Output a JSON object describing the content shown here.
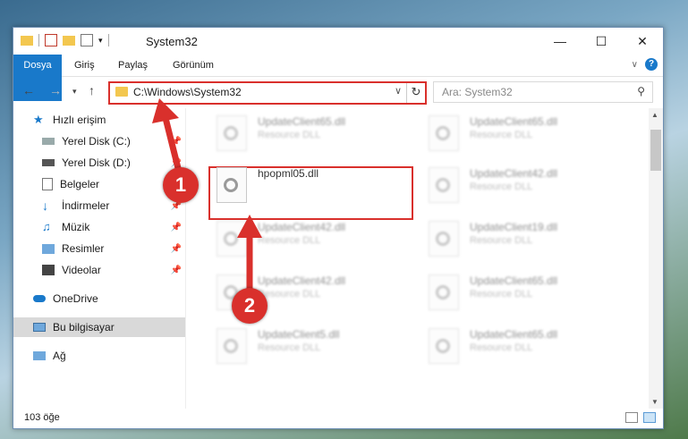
{
  "window": {
    "title": "System32",
    "controls": [
      "minimize-icon",
      "maximize-icon",
      "close-icon"
    ]
  },
  "ribbon": {
    "tabs": [
      "Dosya",
      "Giriş",
      "Paylaş",
      "Görünüm"
    ],
    "accent": "#1979ca"
  },
  "address": {
    "path": "C:\\Windows\\System32",
    "search_placeholder": "Ara: System32"
  },
  "sidebar": {
    "items": [
      {
        "label": "Hızlı erişim",
        "icon": "star-icon",
        "pinned": false
      },
      {
        "label": "Yerel Disk (C:)",
        "icon": "drive-icon",
        "pinned": true
      },
      {
        "label": "Yerel Disk (D:)",
        "icon": "drive-icon",
        "pinned": true
      },
      {
        "label": "Belgeler",
        "icon": "document-icon",
        "pinned": true
      },
      {
        "label": "İndirmeler",
        "icon": "download-icon",
        "pinned": true
      },
      {
        "label": "Müzik",
        "icon": "music-icon",
        "pinned": true
      },
      {
        "label": "Resimler",
        "icon": "picture-icon",
        "pinned": true
      },
      {
        "label": "Videolar",
        "icon": "video-icon",
        "pinned": true
      },
      {
        "label": "OneDrive",
        "icon": "cloud-icon",
        "pinned": false
      },
      {
        "label": "Bu bilgisayar",
        "icon": "computer-icon",
        "pinned": false,
        "selected": true
      },
      {
        "label": "Ağ",
        "icon": "network-icon",
        "pinned": false
      }
    ]
  },
  "files": [
    {
      "name": "UpdateClient65.dll",
      "type": "Resource DLL",
      "blurred": true
    },
    {
      "name": "UpdateClient65.dll",
      "type": "Resource DLL",
      "blurred": true
    },
    {
      "name": "hpopml05.dll",
      "type": "",
      "blurred": false,
      "highlighted": true
    },
    {
      "name": "UpdateClient42.dll",
      "type": "Resource DLL",
      "blurred": true
    },
    {
      "name": "UpdateClient42.dll",
      "type": "Resource DLL",
      "blurred": true
    },
    {
      "name": "UpdateClient19.dll",
      "type": "Resource DLL",
      "blurred": true
    },
    {
      "name": "UpdateClient42.dll",
      "type": "Resource DLL",
      "blurred": true
    },
    {
      "name": "UpdateClient65.dll",
      "type": "Resource DLL",
      "blurred": true
    },
    {
      "name": "UpdateClient5.dll",
      "type": "Resource DLL",
      "blurred": true
    },
    {
      "name": "UpdateClient65.dll",
      "type": "Resource DLL",
      "blurred": true
    }
  ],
  "status": {
    "count": "103 öğe"
  },
  "annotations": {
    "step1": "1",
    "step2": "2",
    "color": "#d9302c"
  }
}
